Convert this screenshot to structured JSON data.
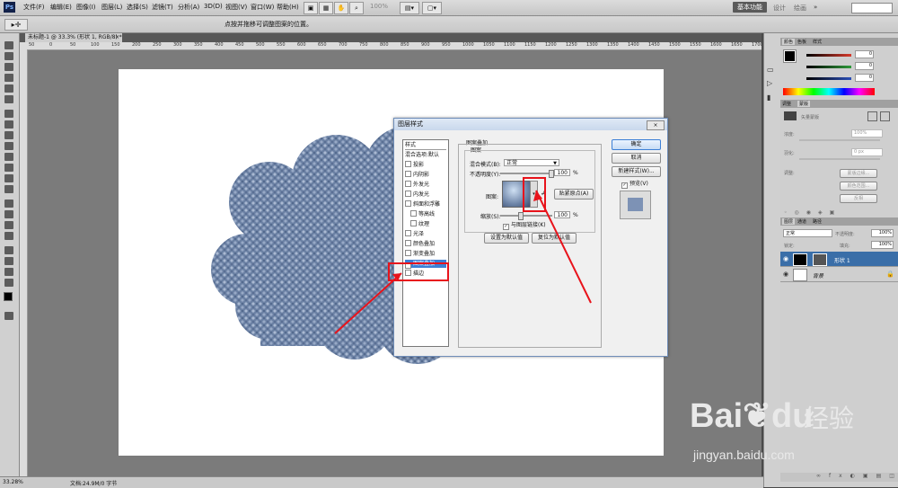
{
  "app": {
    "logo": "Ps"
  },
  "menu": [
    "文件(F)",
    "编辑(E)",
    "图像(I)",
    "图层(L)",
    "选择(S)",
    "滤镜(T)",
    "分析(A)",
    "3D(D)",
    "视图(V)",
    "窗口(W)",
    "帮助(H)"
  ],
  "topbar": {
    "zoom": "100%",
    "workspace_active": "基本功能",
    "workspace_2": "设计",
    "workspace_3": "绘画",
    "workspace_more": "»"
  },
  "options": {
    "hint": "点按并拖移可调整图案的位置。"
  },
  "document": {
    "tab_label": "未标题-1 @ 33.3% (形状 1, RGB/8) *",
    "tab_close": "×"
  },
  "rulers": {
    "h_ticks": [
      "50",
      "0",
      "50",
      "100",
      "150",
      "200",
      "250",
      "300",
      "350",
      "400",
      "450",
      "500",
      "550",
      "600",
      "650",
      "700",
      "750",
      "800",
      "850",
      "900",
      "950",
      "1000",
      "1050",
      "1100",
      "1150",
      "1200",
      "1250",
      "1300",
      "1350",
      "1400",
      "1450",
      "1500",
      "1550",
      "1600",
      "1650",
      "1700"
    ]
  },
  "status": {
    "zoom": "33.28%",
    "doc_size": "文档:24.9M/0 字节"
  },
  "colors": {
    "red_slider": "#d73a2c",
    "green_slider": "#2e9a3a",
    "blue_slider": "#2b4fb8",
    "pattern": "#6e85a8",
    "highlight": "#3c7fd6",
    "annotation": "#e8131b",
    "watermark": "#e7e7e7"
  },
  "color_panel": {
    "tabs": [
      "颜色",
      "色板",
      "样式"
    ],
    "r": "0",
    "g": "0",
    "b": "0"
  },
  "adjust_panel": {
    "tabs": [
      "调整",
      "蒙版"
    ],
    "title": "矢量蒙版",
    "density_label": "浓度:",
    "density": "100%",
    "feather_label": "羽化:",
    "feather": "0 px",
    "refine_label": "调整:",
    "btn_edge": "蒙版边缘...",
    "btn_range": "颜色范围...",
    "btn_invert": "反相"
  },
  "layers_panel": {
    "tabs": [
      "图层",
      "通道",
      "路径"
    ],
    "blend_mode": "正常",
    "opacity_label": "不透明度:",
    "opacity": "100%",
    "lock_label": "锁定:",
    "fill_label": "填充:",
    "fill": "100%",
    "layers": [
      {
        "name": "形状 1"
      },
      {
        "name": "背景"
      }
    ]
  },
  "dialog": {
    "title": "图层样式",
    "close": "×",
    "styles_header": "样式",
    "styles": [
      {
        "label": "混合选项:默认",
        "checkbox": false,
        "checked": false,
        "indent": false
      },
      {
        "label": "投影",
        "checkbox": true,
        "checked": false,
        "indent": false
      },
      {
        "label": "内阴影",
        "checkbox": true,
        "checked": false,
        "indent": false
      },
      {
        "label": "外发光",
        "checkbox": true,
        "checked": false,
        "indent": false
      },
      {
        "label": "内发光",
        "checkbox": true,
        "checked": false,
        "indent": false
      },
      {
        "label": "斜面和浮雕",
        "checkbox": true,
        "checked": false,
        "indent": false
      },
      {
        "label": "等高线",
        "checkbox": true,
        "checked": false,
        "indent": true
      },
      {
        "label": "纹理",
        "checkbox": true,
        "checked": false,
        "indent": true
      },
      {
        "label": "光泽",
        "checkbox": true,
        "checked": false,
        "indent": false
      },
      {
        "label": "颜色叠加",
        "checkbox": true,
        "checked": false,
        "indent": false
      },
      {
        "label": "渐变叠加",
        "checkbox": true,
        "checked": false,
        "indent": false
      },
      {
        "label": "图案叠加",
        "checkbox": true,
        "checked": true,
        "indent": false,
        "selected": true
      },
      {
        "label": "描边",
        "checkbox": true,
        "checked": false,
        "indent": false
      }
    ],
    "group_title": "图案叠加",
    "sub_title": "图案",
    "blend_label": "混合模式(B):",
    "blend_value": "正常",
    "opacity_label": "不透明度(Y):",
    "opacity_value": "100",
    "percent": "%",
    "pattern_label": "图案:",
    "snap_btn": "贴紧原点(A)",
    "scale_label": "缩放(S):",
    "scale_value": "100",
    "link_label": "与图层链接(K)",
    "set_default_btn": "设置为默认值",
    "reset_default_btn": "复位为默认值",
    "ok": "确定",
    "cancel": "取消",
    "new_style": "新建样式(W)...",
    "preview": "预览(V)"
  },
  "watermark": {
    "brand": "Bai",
    "brand_tail": "du",
    "cn": "经验",
    "url": "jingyan.baidu.com"
  }
}
